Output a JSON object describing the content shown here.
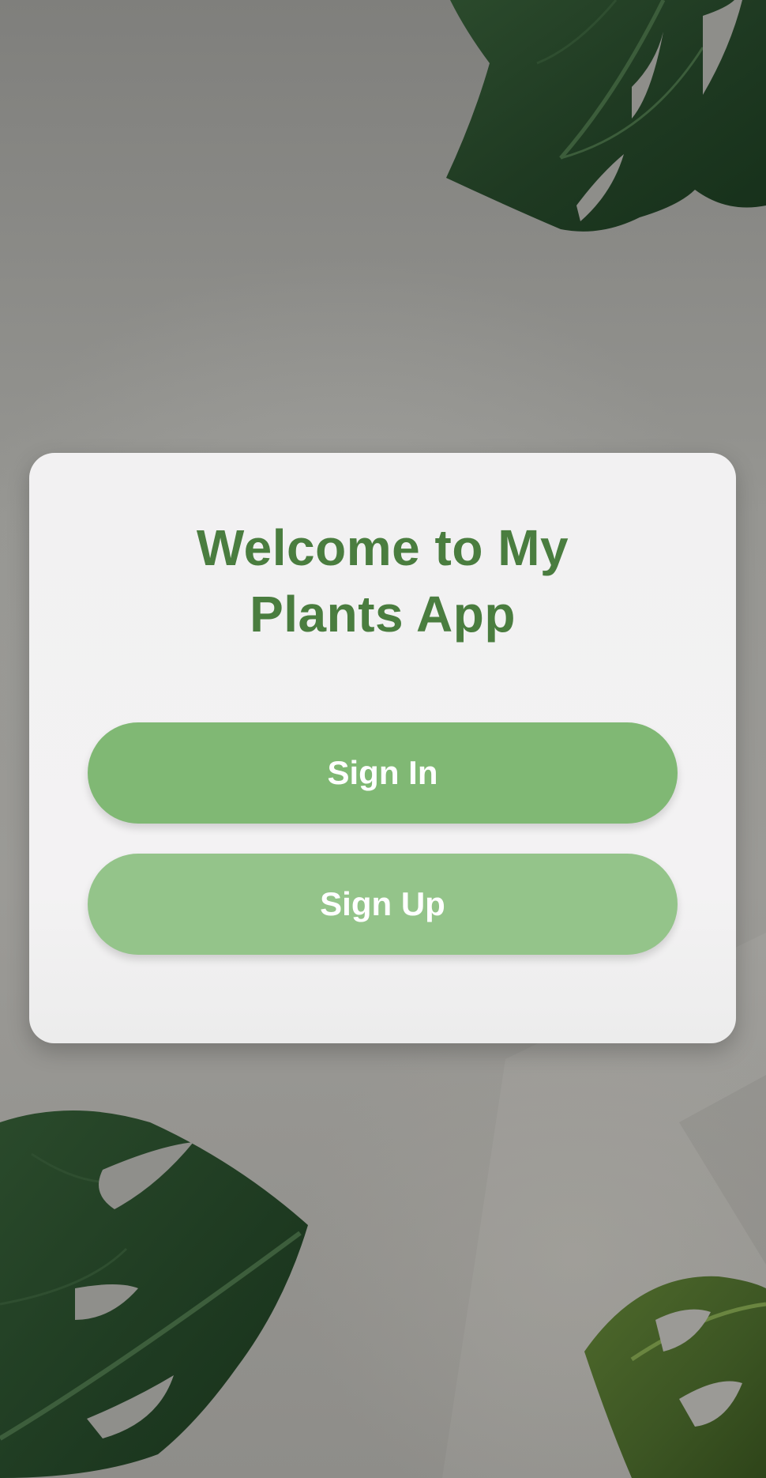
{
  "welcome": {
    "title": "Welcome to My Plants App"
  },
  "actions": {
    "sign_in_label": "Sign In",
    "sign_up_label": "Sign Up"
  },
  "colors": {
    "title_green": "#4a7d3f",
    "sign_in_button": "#80b874",
    "sign_up_button": "#94c48a",
    "card_background": "#f2f1f2",
    "page_background": "#969692"
  },
  "decor": {
    "background_image": "monstera-leaves-on-grey"
  }
}
